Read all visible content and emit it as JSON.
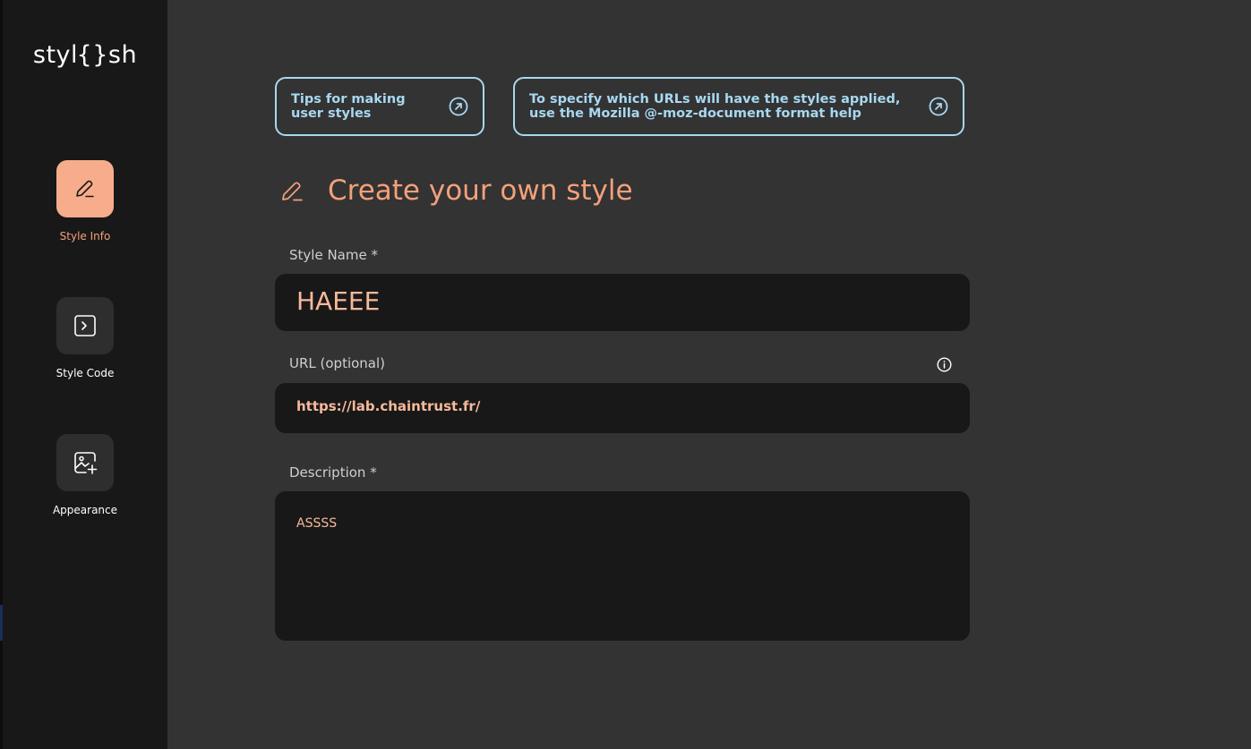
{
  "app": {
    "logo_text": "styl{}sh"
  },
  "sidebar": {
    "items": [
      {
        "label": "Style Info",
        "icon": "edit-icon",
        "active": true
      },
      {
        "label": "Style Code",
        "icon": "code-icon",
        "active": false
      },
      {
        "label": "Appearance",
        "icon": "image-add-icon",
        "active": false
      }
    ]
  },
  "tips": [
    {
      "line1": "Tips for making",
      "line2": "user styles",
      "icon": "external-link-icon"
    },
    {
      "line1": "To specify which URLs will have the styles applied,",
      "line2": "use the Mozilla @-moz-document format help",
      "icon": "external-link-icon"
    }
  ],
  "main": {
    "title": "Create your own style",
    "title_icon": "edit-icon",
    "fields": {
      "style_name": {
        "label": "Style Name *",
        "value": "HAEEE"
      },
      "url": {
        "label": "URL (optional)",
        "value": "https://lab.chaintrust.fr/",
        "info_icon": "info-icon"
      },
      "description": {
        "label": "Description *",
        "value": "ASSSS"
      }
    }
  },
  "colors": {
    "accent": "#f4a07b",
    "active_nav_bg": "#f7ad8c",
    "tip_border": "#a8d8f0",
    "sidebar_bg": "#181818",
    "main_bg": "#333333",
    "field_bg": "#181818"
  }
}
